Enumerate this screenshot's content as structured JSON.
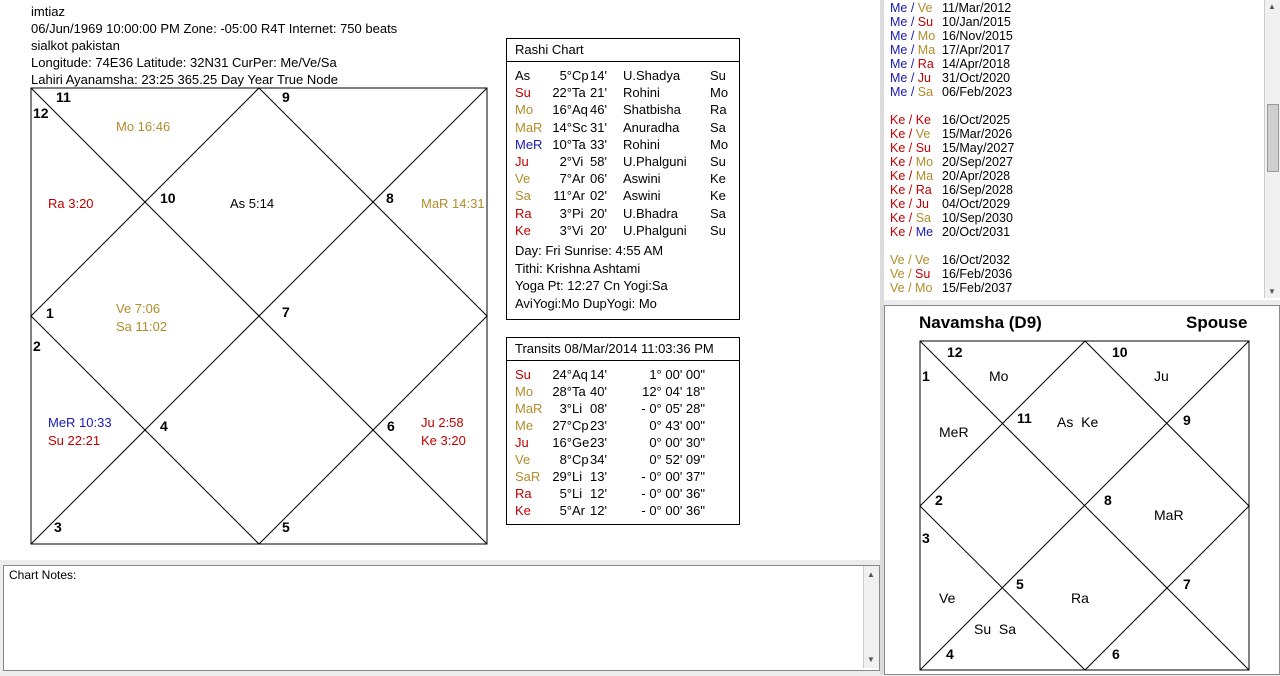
{
  "header": {
    "lines": [
      "imtiaz",
      "06/Jun/1969 10:00:00 PM Zone: -05:00 R4T  Internet: 750 beats",
      "sialkot pakistan",
      "Longitude: 74E36  Latitude: 32N31  CurPer: Me/Ve/Sa",
      "Lahiri Ayanamsha: 23:25  365.25 Day Year   True Node"
    ]
  },
  "colors": {
    "red": "#c00000",
    "gold": "#b08d2a",
    "blue": "#1a1ab0",
    "purple": "#7a1fa2",
    "black": "#000000"
  },
  "main_chart": {
    "house_numbers": [
      "11",
      "12",
      "9",
      "10",
      "8",
      "1",
      "7",
      "2",
      "4",
      "6",
      "3",
      "5"
    ],
    "planets": {
      "mo": "Mo 16:46",
      "ra": "Ra 3:20",
      "as": "As 5:14",
      "mar": "MaR 14:31",
      "ve": "Ve 7:06",
      "sa": "Sa 11:02",
      "mer": "MeR 10:33",
      "su": "Su 22:21",
      "ju": "Ju 2:58",
      "ke": "Ke 3:20"
    }
  },
  "rashi": {
    "title": "Rashi Chart",
    "rows": [
      {
        "p": "As",
        "deg": "5°",
        "sign": "Cp",
        "min": "14'",
        "nak": "U.Shadya",
        "lord": "Su",
        "color": "black"
      },
      {
        "p": "Su",
        "deg": "22°",
        "sign": "Ta",
        "min": "21'",
        "nak": "Rohini",
        "lord": "Mo",
        "color": "red"
      },
      {
        "p": "Mo",
        "deg": "16°",
        "sign": "Aq",
        "min": "46'",
        "nak": "Shatbisha",
        "lord": "Ra",
        "color": "gold"
      },
      {
        "p": "MaR",
        "deg": "14°",
        "sign": "Sc",
        "min": "31'",
        "nak": "Anuradha",
        "lord": "Sa",
        "color": "gold"
      },
      {
        "p": "MeR",
        "deg": "10°",
        "sign": "Ta",
        "min": "33'",
        "nak": "Rohini",
        "lord": "Mo",
        "color": "blue"
      },
      {
        "p": "Ju",
        "deg": "2°",
        "sign": "Vi",
        "min": "58'",
        "nak": "U.Phalguni",
        "lord": "Su",
        "color": "red"
      },
      {
        "p": "Ve",
        "deg": "7°",
        "sign": "Ar",
        "min": "06'",
        "nak": "Aswini",
        "lord": "Ke",
        "color": "gold"
      },
      {
        "p": "Sa",
        "deg": "11°",
        "sign": "Ar",
        "min": "02'",
        "nak": "Aswini",
        "lord": "Ke",
        "color": "gold"
      },
      {
        "p": "Ra",
        "deg": "3°",
        "sign": "Pi",
        "min": "20'",
        "nak": "U.Bhadra",
        "lord": "Sa",
        "color": "red"
      },
      {
        "p": "Ke",
        "deg": "3°",
        "sign": "Vi",
        "min": "20'",
        "nak": "U.Phalguni",
        "lord": "Su",
        "color": "red"
      }
    ],
    "info": [
      "Day: Fri   Sunrise: 4:55 AM",
      "Tithi:  Krishna Ashtami",
      "Yoga Pt: 12:27 Cn  Yogi:Sa",
      "AviYogi:Mo  DupYogi: Mo"
    ]
  },
  "transits": {
    "title": "Transits 08/Mar/2014 11:03:36 PM",
    "rows": [
      {
        "p": "Su",
        "deg": "24°",
        "sign": "Aq",
        "min": "14'",
        "speed": "1° 00' 00\"",
        "color": "red"
      },
      {
        "p": "Mo",
        "deg": "28°",
        "sign": "Ta",
        "min": "40'",
        "speed": "12° 04' 18\"",
        "color": "gold"
      },
      {
        "p": "MaR",
        "deg": "3°",
        "sign": "Li",
        "min": "08'",
        "speed": "- 0° 05' 28\"",
        "color": "gold"
      },
      {
        "p": "Me",
        "deg": "27°",
        "sign": "Cp",
        "min": "23'",
        "speed": "0° 43' 00\"",
        "color": "gold"
      },
      {
        "p": "Ju",
        "deg": "16°",
        "sign": "Ge",
        "min": "23'",
        "speed": "0° 00' 30\"",
        "color": "red"
      },
      {
        "p": "Ve",
        "deg": "8°",
        "sign": "Cp",
        "min": "34'",
        "speed": "0° 52' 09\"",
        "color": "gold"
      },
      {
        "p": "SaR",
        "deg": "29°",
        "sign": "Li",
        "min": "13'",
        "speed": "- 0° 00' 37\"",
        "color": "gold"
      },
      {
        "p": "Ra",
        "deg": "5°",
        "sign": "Li",
        "min": "12'",
        "speed": "- 0° 00' 36\"",
        "color": "red"
      },
      {
        "p": "Ke",
        "deg": "5°",
        "sign": "Ar",
        "min": "12'",
        "speed": "- 0° 00' 36\"",
        "color": "red"
      }
    ]
  },
  "notes": {
    "label": "Chart Notes:"
  },
  "dasha": {
    "rows": [
      {
        "a": "Me",
        "b": "Ve",
        "date": "11/Mar/2012",
        "ca": "blue",
        "cb": "gold"
      },
      {
        "a": "Me",
        "b": "Su",
        "date": "10/Jan/2015",
        "ca": "blue",
        "cb": "red"
      },
      {
        "a": "Me",
        "b": "Mo",
        "date": "16/Nov/2015",
        "ca": "blue",
        "cb": "gold"
      },
      {
        "a": "Me",
        "b": "Ma",
        "date": "17/Apr/2017",
        "ca": "blue",
        "cb": "gold"
      },
      {
        "a": "Me",
        "b": "Ra",
        "date": "14/Apr/2018",
        "ca": "blue",
        "cb": "red"
      },
      {
        "a": "Me",
        "b": "Ju",
        "date": "31/Oct/2020",
        "ca": "blue",
        "cb": "red"
      },
      {
        "a": "Me",
        "b": "Sa",
        "date": "06/Feb/2023",
        "ca": "blue",
        "cb": "gold"
      },
      {
        "a": "",
        "b": "",
        "date": "",
        "ca": "black",
        "cb": "black"
      },
      {
        "a": "Ke",
        "b": "Ke",
        "date": "16/Oct/2025",
        "ca": "red",
        "cb": "red"
      },
      {
        "a": "Ke",
        "b": "Ve",
        "date": "15/Mar/2026",
        "ca": "red",
        "cb": "gold"
      },
      {
        "a": "Ke",
        "b": "Su",
        "date": "15/May/2027",
        "ca": "red",
        "cb": "red"
      },
      {
        "a": "Ke",
        "b": "Mo",
        "date": "20/Sep/2027",
        "ca": "red",
        "cb": "gold"
      },
      {
        "a": "Ke",
        "b": "Ma",
        "date": "20/Apr/2028",
        "ca": "red",
        "cb": "gold"
      },
      {
        "a": "Ke",
        "b": "Ra",
        "date": "16/Sep/2028",
        "ca": "red",
        "cb": "red"
      },
      {
        "a": "Ke",
        "b": "Ju",
        "date": "04/Oct/2029",
        "ca": "red",
        "cb": "red"
      },
      {
        "a": "Ke",
        "b": "Sa",
        "date": "10/Sep/2030",
        "ca": "red",
        "cb": "gold"
      },
      {
        "a": "Ke",
        "b": "Me",
        "date": "20/Oct/2031",
        "ca": "red",
        "cb": "blue"
      },
      {
        "a": "",
        "b": "",
        "date": "",
        "ca": "black",
        "cb": "black"
      },
      {
        "a": "Ve",
        "b": "Ve",
        "date": "16/Oct/2032",
        "ca": "gold",
        "cb": "gold"
      },
      {
        "a": "Ve",
        "b": "Su",
        "date": "16/Feb/2036",
        "ca": "gold",
        "cb": "red"
      },
      {
        "a": "Ve",
        "b": "Mo",
        "date": "15/Feb/2037",
        "ca": "gold",
        "cb": "gold"
      }
    ]
  },
  "navamsha": {
    "title": "Navamsha (D9)",
    "subtitle": "Spouse",
    "house_numbers": [
      "12",
      "10",
      "1",
      "11",
      "9",
      "2",
      "8",
      "3",
      "5",
      "7",
      "4",
      "6"
    ],
    "planets": {
      "mo": "Mo",
      "ju": "Ju",
      "mer": "MeR",
      "aske": "As  Ke",
      "mar": "MaR",
      "ve": "Ve",
      "ra": "Ra",
      "susa": "Su  Sa"
    }
  }
}
